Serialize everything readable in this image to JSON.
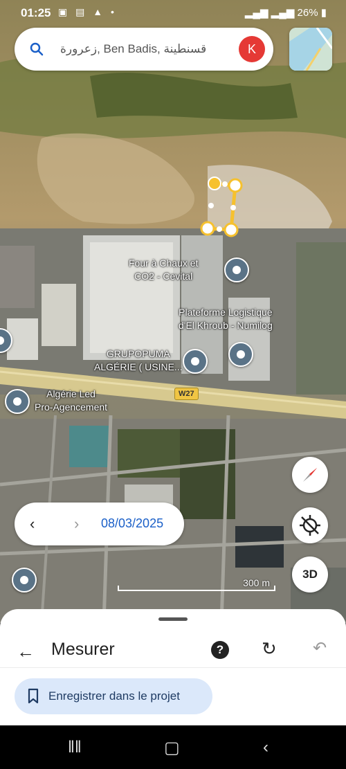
{
  "status_bar": {
    "time": "01:25",
    "left_icons": "▣ ▤ ▲ •",
    "right_text": "26%"
  },
  "search": {
    "query": "زعرورة, Ben Badis, قسنطينة",
    "avatar_letter": "K"
  },
  "places": {
    "p1": "Four à Chaux et\nCO2 - Cevital",
    "p2": "Plateforme Logistique\nd'El Khroub - Numilog",
    "p3": "GRUPOPUMA\nALGÉRIE ( USINE...",
    "p4": "Algérie Led\nPro-Agencement"
  },
  "road_label": "W27",
  "timeline": {
    "date": "08/03/2025",
    "prev_icon": "chevron-left-icon",
    "next_icon": "chevron-right-icon"
  },
  "controls": {
    "three_d_label": "3D"
  },
  "scale_label": "300 m",
  "sheet": {
    "title": "Mesurer",
    "save_label": "Enregistrer dans le projet"
  },
  "colors": {
    "accent": "#1a5fc8",
    "measure_line": "#f6c12e",
    "avatar": "#e53935",
    "save_bg": "#dbe8fa"
  }
}
